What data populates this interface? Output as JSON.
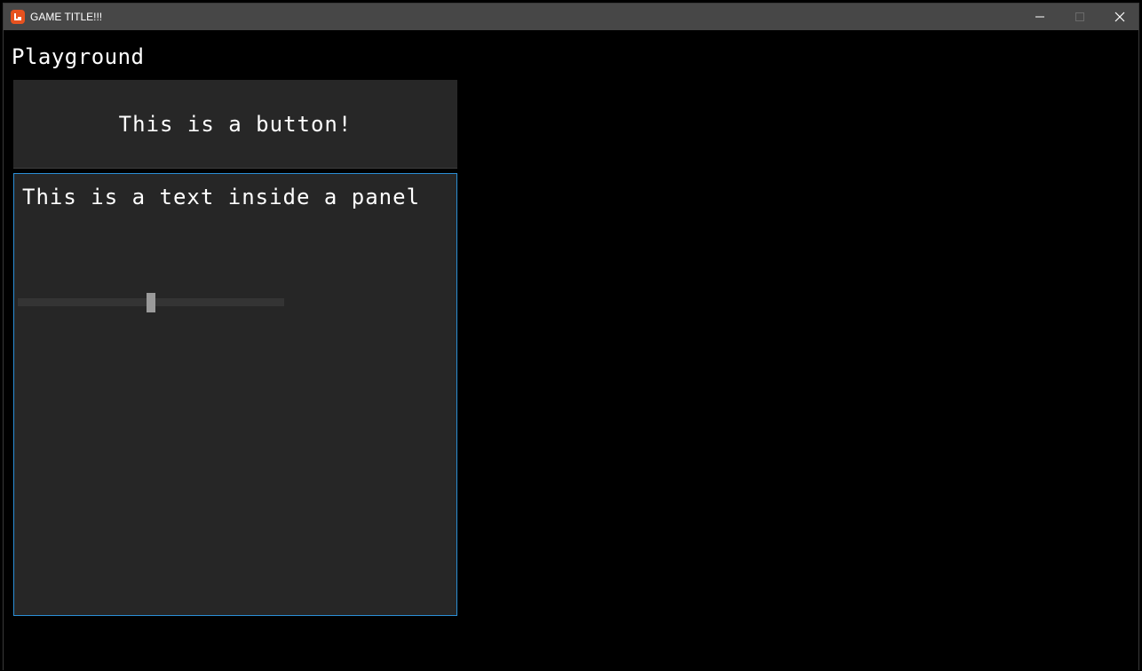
{
  "window": {
    "title": "GAME TITLE!!!"
  },
  "content": {
    "heading": "Playground",
    "button_label": "This is a button!",
    "panel_text": "This is a text inside a panel",
    "slider": {
      "value_fraction": 0.5
    }
  },
  "colors": {
    "titlebar": "#474747",
    "background": "#000000",
    "widget": "#272727",
    "panel_border": "#2b8fd6",
    "slider_thumb": "#9a9a9a",
    "app_icon": "#e7521f"
  },
  "icons": {
    "app": "monogame-logo-icon",
    "minimize": "minimize-icon",
    "maximize": "maximize-icon",
    "close": "close-icon"
  }
}
